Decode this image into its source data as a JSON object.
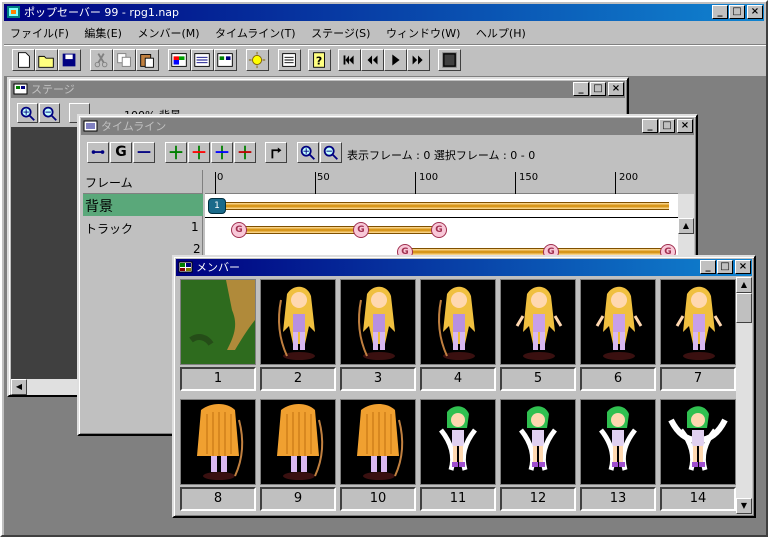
{
  "app": {
    "title": "ポップセーバー 99 - rpg1.nap",
    "menu": [
      "ファイル(F)",
      "編集(E)",
      "メンバー(M)",
      "タイムライン(T)",
      "ステージ(S)",
      "ウィンドウ(W)",
      "ヘルプ(H)"
    ]
  },
  "stage": {
    "title": "ステージ",
    "status": "100% 背景"
  },
  "timeline": {
    "title": "タイムライン",
    "g_label": "G",
    "status": "表示フレーム : 0 選択フレーム : 0 - 0",
    "frame_label": "フレーム",
    "ruler": [
      "0",
      "50",
      "100",
      "150",
      "200"
    ],
    "bg_label": "背景",
    "track_label": "トラック",
    "track_num_1": "1",
    "track_num_2": "2",
    "marker_1": "1",
    "marker_g": "G"
  },
  "member": {
    "title": "メンバー",
    "items": [
      "1",
      "2",
      "3",
      "4",
      "5",
      "6",
      "7",
      "8",
      "9",
      "10",
      "11",
      "12",
      "13",
      "14"
    ]
  },
  "colors": {
    "active_title": "#000080",
    "bg_row": "#5aa87a",
    "accent_orange": "#d08800"
  }
}
